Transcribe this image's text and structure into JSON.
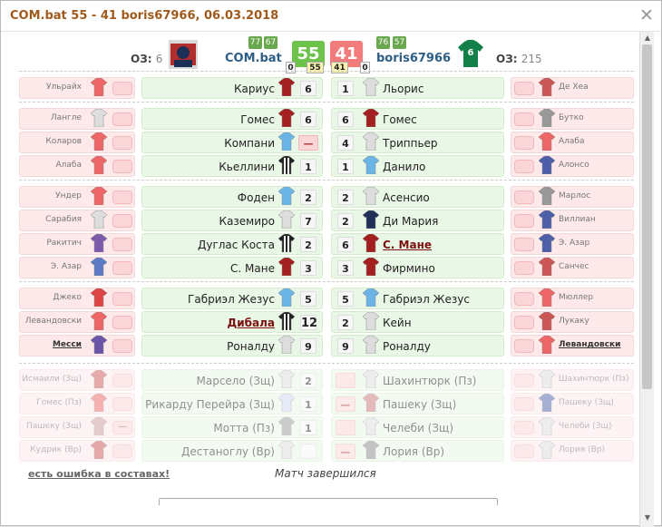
{
  "window": {
    "title": "COM.bat 55 - 41 boris67966, 06.03.2018"
  },
  "header": {
    "left": {
      "oz_label": "ОЗ:",
      "oz_value": "6",
      "team": "COM.bat",
      "tours": [
        "77",
        "67"
      ],
      "score": "55",
      "sub_a": "0",
      "sub_b": "55"
    },
    "right": {
      "oz_label": "ОЗ:",
      "oz_value": "215",
      "team": "boris67966",
      "tours": [
        "76",
        "57"
      ],
      "score": "41",
      "sub_a": "41",
      "sub_b": "0",
      "jersey_number": "6"
    },
    "colors": {
      "left_score": "#6cc24a",
      "right_score": "#f27c7c"
    }
  },
  "rows": [
    {
      "ls": "Ульрайх",
      "lm": "Кариус",
      "lp": "6",
      "rp": "1",
      "rm": "Льорис",
      "rs": "Де Хеа"
    },
    {
      "ls": "Лангле",
      "lm": "Гомес",
      "lp": "6",
      "rp": "6",
      "rm": "Гомес",
      "rs": "Бутко"
    },
    {
      "ls": "Коларов",
      "lm": "Компани",
      "lp": "—",
      "rp": "4",
      "rm": "Триппьер",
      "rs": "Алаба"
    },
    {
      "ls": "Алаба",
      "lm": "Кьеллини",
      "lp": "1",
      "rp": "1",
      "rm": "Данило",
      "rs": "Алонсо"
    },
    {
      "ls": "Ундер",
      "lm": "Фоден",
      "lp": "2",
      "rp": "2",
      "rm": "Асенсио",
      "rs": "Марлос"
    },
    {
      "ls": "Сарабия",
      "lm": "Каземиро",
      "lp": "7",
      "rp": "2",
      "rm": "Ди Мария",
      "rs": "Виллиан"
    },
    {
      "ls": "Ракитич",
      "lm": "Дуглас Коста",
      "lp": "2",
      "rp": "6",
      "rm": "С. Мане",
      "rs": "Э. Азар"
    },
    {
      "ls": "Э. Азар",
      "lm": "С. Мане",
      "lp": "3",
      "rp": "3",
      "rm": "Фирмино",
      "rs": "Санчес"
    },
    {
      "ls": "Джеко",
      "lm": "Габриэл Жезус",
      "lp": "5",
      "rp": "5",
      "rm": "Габриэл Жезус",
      "rs": "Мюллер"
    },
    {
      "ls": "Левандовски",
      "lm": "Дибала",
      "lp": "12",
      "rp": "2",
      "rm": "Кейн",
      "rs": "Лукаку"
    },
    {
      "ls": "Месси",
      "lm": "Роналду",
      "lp": "9",
      "rp": "9",
      "rm": "Роналду",
      "rs": "Левандовски"
    },
    {
      "ls": "Исмаили (Зщ)",
      "lm": "Марсело (Зщ)",
      "lp": "2",
      "rp": "",
      "rm": "Шахинтюрк (Пз)",
      "rs": "Шахинтюрк (Пз)"
    },
    {
      "ls": "Гомес (Пз)",
      "lm": "Рикарду Перейра (Зщ)",
      "lp": "1",
      "rp": "—",
      "rm": "Пашеку (Зщ)",
      "rs": "Пашеку (Зщ)"
    },
    {
      "ls": "Пашеку (Зщ)",
      "lm": "Мотта (Пз)",
      "lp": "1",
      "rp": "",
      "rm": "Челеби (Зщ)",
      "rs": "Челеби (Зщ)"
    },
    {
      "ls": "Кудрик (Вр)",
      "lm": "Дестаноглу (Вр)",
      "lp": "",
      "rp": "—",
      "rm": "Лория (Вр)",
      "rs": "Лория (Вр)"
    }
  ],
  "footer": {
    "error_link": "есть ошибка в составах!",
    "status": "Матч завершился"
  }
}
